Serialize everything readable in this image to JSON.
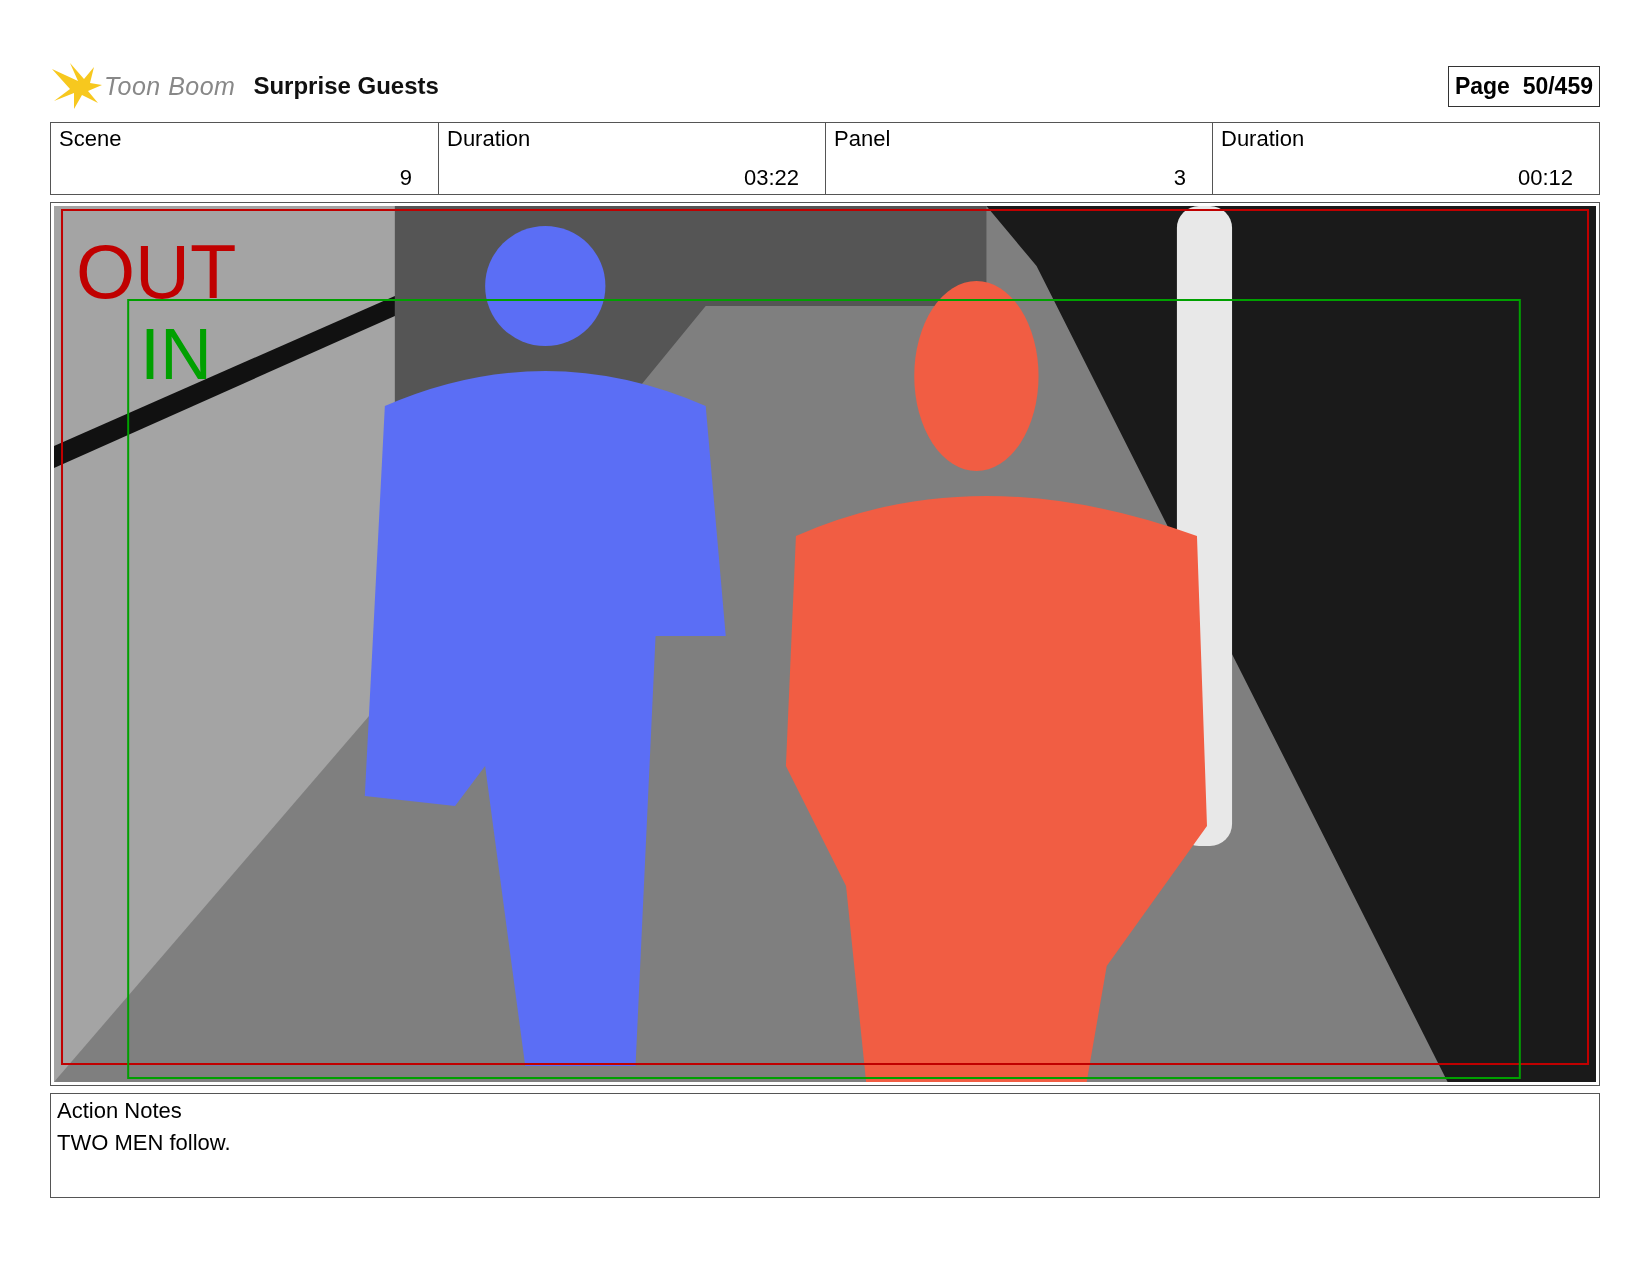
{
  "header": {
    "logo_text": "Toon Boom",
    "project_title": "Surprise Guests",
    "page": "Page  50/459"
  },
  "info": [
    {
      "label": "Scene",
      "value": "9"
    },
    {
      "label": "Duration",
      "value": "03:22"
    },
    {
      "label": "Panel",
      "value": "3"
    },
    {
      "label": "Duration",
      "value": "00:12"
    }
  ],
  "panel": {
    "overlays": [
      {
        "label": "OUT",
        "color": "#c00000"
      },
      {
        "label": "IN",
        "color": "#00a000"
      }
    ]
  },
  "notes": {
    "title": "Action Notes",
    "text": "TWO MEN follow."
  }
}
